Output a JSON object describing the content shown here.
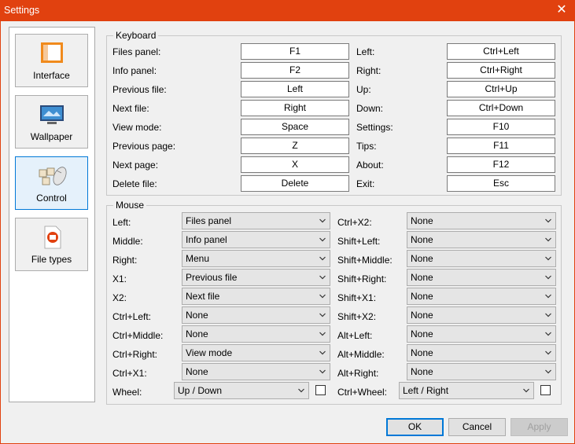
{
  "window": {
    "title": "Settings"
  },
  "sidebar": {
    "items": [
      {
        "label": "Interface",
        "icon": "interface-icon"
      },
      {
        "label": "Wallpaper",
        "icon": "wallpaper-icon"
      },
      {
        "label": "Control",
        "icon": "control-icon",
        "active": true
      },
      {
        "label": "File types",
        "icon": "file-types-icon"
      }
    ]
  },
  "keyboard": {
    "title": "Keyboard",
    "left": [
      {
        "label": "Files panel:",
        "value": "F1"
      },
      {
        "label": "Info panel:",
        "value": "F2"
      },
      {
        "label": "Previous file:",
        "value": "Left"
      },
      {
        "label": "Next file:",
        "value": "Right"
      },
      {
        "label": "View mode:",
        "value": "Space"
      },
      {
        "label": "Previous page:",
        "value": "Z"
      },
      {
        "label": "Next page:",
        "value": "X"
      },
      {
        "label": "Delete file:",
        "value": "Delete"
      }
    ],
    "right": [
      {
        "label": "Left:",
        "value": "Ctrl+Left"
      },
      {
        "label": "Right:",
        "value": "Ctrl+Right"
      },
      {
        "label": "Up:",
        "value": "Ctrl+Up"
      },
      {
        "label": "Down:",
        "value": "Ctrl+Down"
      },
      {
        "label": "Settings:",
        "value": "F10"
      },
      {
        "label": "Tips:",
        "value": "F11"
      },
      {
        "label": "About:",
        "value": "F12"
      },
      {
        "label": "Exit:",
        "value": "Esc"
      }
    ]
  },
  "mouse": {
    "title": "Mouse",
    "left": [
      {
        "label": "Left:",
        "value": "Files panel"
      },
      {
        "label": "Middle:",
        "value": "Info panel"
      },
      {
        "label": "Right:",
        "value": "Menu"
      },
      {
        "label": "X1:",
        "value": "Previous file"
      },
      {
        "label": "X2:",
        "value": "Next file"
      },
      {
        "label": "Ctrl+Left:",
        "value": "None"
      },
      {
        "label": "Ctrl+Middle:",
        "value": "None"
      },
      {
        "label": "Ctrl+Right:",
        "value": "View mode"
      },
      {
        "label": "Ctrl+X1:",
        "value": "None"
      }
    ],
    "right": [
      {
        "label": "Ctrl+X2:",
        "value": "None"
      },
      {
        "label": "Shift+Left:",
        "value": "None"
      },
      {
        "label": "Shift+Middle:",
        "value": "None"
      },
      {
        "label": "Shift+Right:",
        "value": "None"
      },
      {
        "label": "Shift+X1:",
        "value": "None"
      },
      {
        "label": "Shift+X2:",
        "value": "None"
      },
      {
        "label": "Alt+Left:",
        "value": "None"
      },
      {
        "label": "Alt+Middle:",
        "value": "None"
      },
      {
        "label": "Alt+Right:",
        "value": "None"
      }
    ],
    "wheel": {
      "label": "Wheel:",
      "value": "Up / Down",
      "checked": false
    },
    "ctrl_wheel": {
      "label": "Ctrl+Wheel:",
      "value": "Left / Right",
      "checked": false
    }
  },
  "buttons": {
    "ok": "OK",
    "cancel": "Cancel",
    "apply": "Apply"
  },
  "colors": {
    "titlebar": "#e1410f",
    "accent": "#0078d7"
  }
}
